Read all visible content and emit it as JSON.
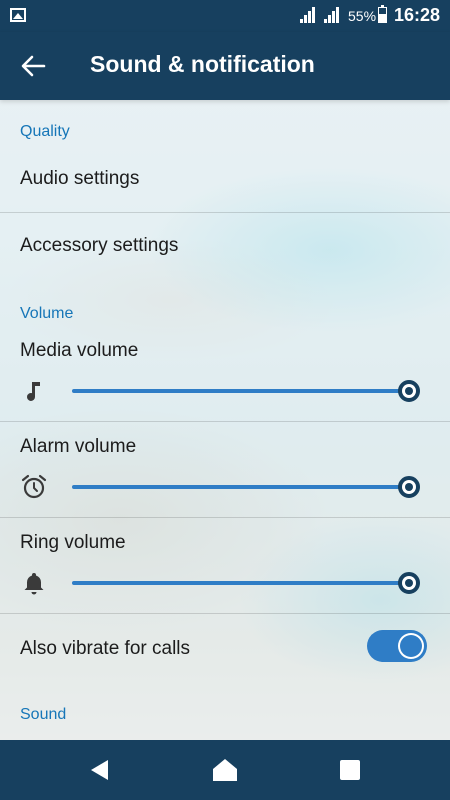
{
  "status_bar": {
    "battery": "55%",
    "time": "16:28",
    "icons": [
      "gallery-icon",
      "signal-icon",
      "signal-icon",
      "battery-icon"
    ]
  },
  "app_bar": {
    "title": "Sound & notification",
    "back_icon": "back-arrow-icon"
  },
  "sections": {
    "quality": {
      "header": "Quality",
      "items": [
        "Audio settings",
        "Accessory settings"
      ]
    },
    "volume": {
      "header": "Volume",
      "sliders": [
        {
          "label": "Media volume",
          "icon": "music-note-icon",
          "level": 1.0
        },
        {
          "label": "Alarm volume",
          "icon": "alarm-clock-icon",
          "level": 1.0
        },
        {
          "label": "Ring volume",
          "icon": "bell-icon",
          "level": 1.0
        }
      ],
      "vibrate": {
        "label": "Also vibrate for calls",
        "on": true
      }
    },
    "sound": {
      "header": "Sound"
    }
  },
  "nav_bar": {
    "buttons": [
      "back-triangle-icon",
      "home-icon",
      "recents-square-icon"
    ]
  },
  "colors": {
    "primary_dark": "#17405f",
    "accent": "#2f7dc6",
    "section_header": "#1676b8"
  }
}
